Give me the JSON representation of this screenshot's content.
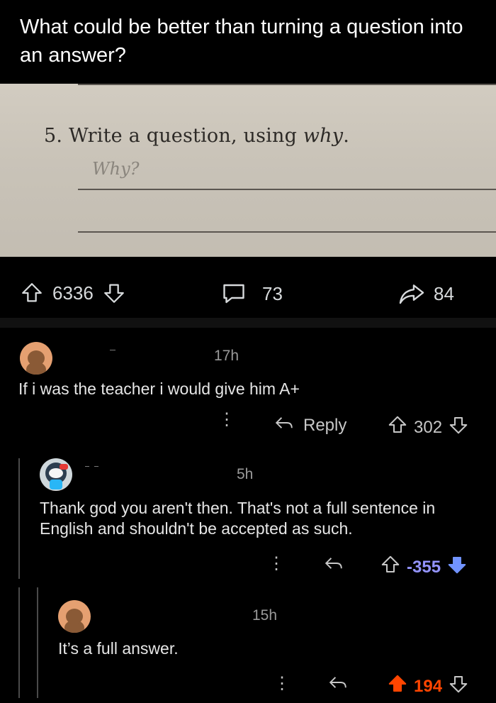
{
  "post": {
    "title": "What could be better than turning a question into an answer?",
    "image": {
      "question": "5. Write a question, using ",
      "question_italic": "why",
      "question_end": ".",
      "handwritten": "Why?"
    },
    "votes": "6336",
    "comments": "73",
    "shares": "84"
  },
  "comments": [
    {
      "time": "17h",
      "text": "If i was the teacher i would give him A+",
      "reply_label": "Reply",
      "score": "302",
      "vote_state": "none"
    },
    {
      "time": "5h",
      "text": "Thank god you aren't then. That's not a full sentence in English and shouldn't be accepted as such.",
      "score": "-355",
      "vote_state": "down",
      "score_color": "#9494ff"
    },
    {
      "time": "15h",
      "text": "It’s a full answer.",
      "score": "194",
      "vote_state": "up",
      "score_color": "#ff4500"
    }
  ],
  "icons": [
    "upvote-icon",
    "downvote-icon",
    "comment-icon",
    "share-icon",
    "reply-icon",
    "more-icon",
    "avatar"
  ]
}
